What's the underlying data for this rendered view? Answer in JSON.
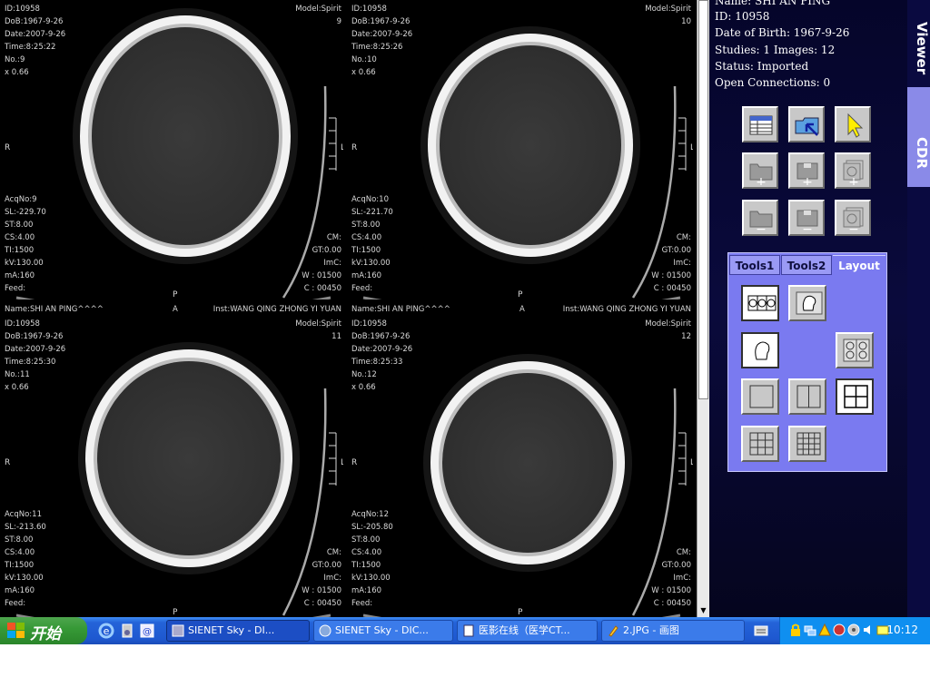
{
  "viewports": [
    {
      "top_left": [
        "ID:10958",
        "DoB:1967-9-26",
        "Date:2007-9-26",
        "Time:8:25:22",
        "No.:9",
        "x 0.66"
      ],
      "top_right": [
        "Model:Spirit",
        "9"
      ],
      "bottom_left": [
        "AcqNo:9",
        "SL:-229.70",
        "ST:8.00",
        "CS:4.00",
        "TI:1500",
        "kV:130.00",
        "mA:160",
        "Feed:"
      ],
      "bottom_right": [
        "CM:",
        "GT:0.00",
        "ImC:",
        "W : 01500",
        "C : 00450"
      ],
      "left_label": "R",
      "bottom_label": "P"
    },
    {
      "top_left": [
        "ID:10958",
        "DoB:1967-9-26",
        "Date:2007-9-26",
        "Time:8:25:26",
        "No.:10",
        "x 0.66"
      ],
      "top_right": [
        "Model:Spirit",
        "10"
      ],
      "bottom_left": [
        "AcqNo:10",
        "SL:-221.70",
        "ST:8.00",
        "CS:4.00",
        "TI:1500",
        "kV:130.00",
        "mA:160",
        "Feed:"
      ],
      "bottom_right": [
        "CM:",
        "GT:0.00",
        "ImC:",
        "W : 01500",
        "C : 00450"
      ],
      "left_label": "R",
      "bottom_label": "P"
    },
    {
      "header": [
        "Name:SHI AN PING^^^^",
        "A",
        "Inst:WANG QING ZHONG YI YUAN"
      ],
      "top_left": [
        "ID:10958",
        "DoB:1967-9-26",
        "Date:2007-9-26",
        "Time:8:25:30",
        "No.:11",
        "x 0.66"
      ],
      "top_right": [
        "Model:Spirit",
        "11"
      ],
      "bottom_left": [
        "AcqNo:11",
        "SL:-213.60",
        "ST:8.00",
        "CS:4.00",
        "TI:1500",
        "kV:130.00",
        "mA:160",
        "Feed:"
      ],
      "bottom_right": [
        "CM:",
        "GT:0.00",
        "ImC:",
        "W : 01500",
        "C : 00450"
      ],
      "left_label": "R",
      "bottom_label": "P"
    },
    {
      "header": [
        "Name:SHI AN PING^^^^",
        "A",
        "Inst:WANG QING ZHONG YI YUAN"
      ],
      "top_left": [
        "ID:10958",
        "DoB:1967-9-26",
        "Date:2007-9-26",
        "Time:8:25:33",
        "No.:12",
        "x 0.66"
      ],
      "top_right": [
        "Model:Spirit",
        "12"
      ],
      "bottom_left": [
        "AcqNo:12",
        "SL:-205.80",
        "ST:8.00",
        "CS:4.00",
        "TI:1500",
        "kV:130.00",
        "mA:160",
        "Feed:"
      ],
      "bottom_right": [
        "CM:",
        "GT:0.00",
        "ImC:",
        "W : 01500",
        "C : 00450"
      ],
      "left_label": "R",
      "bottom_label": "P"
    }
  ],
  "scale_marker": "L",
  "patient_info": {
    "name": "Name:  SHI AN PING",
    "id": "ID:  10958",
    "dob": "Date of Birth: 1967-9-26",
    "studies": "Studies: 1 Images: 12",
    "status": "Status: Imported",
    "connections": "Open Connections: 0"
  },
  "toolbox": {
    "tabs": [
      "Tools1",
      "Tools2",
      "Layout"
    ],
    "active_tab": "Layout"
  },
  "side_tabs": [
    "Viewer",
    "CDR"
  ],
  "taskbar": {
    "start_label": "开始",
    "tasks": [
      {
        "label": "SIENET Sky  - DI...",
        "active": true
      },
      {
        "label": "SIENET Sky - DIC...",
        "active": false
      },
      {
        "label": "医影在线（医学CT...",
        "active": false
      },
      {
        "label": "2.JPG - 画图",
        "active": false
      }
    ],
    "clock": "10:12"
  },
  "colors": {
    "panel_bg": "#0a0a3c",
    "toolbox_bg": "#7a7af0",
    "taskbar": "#245edb",
    "start": "#379a37"
  }
}
